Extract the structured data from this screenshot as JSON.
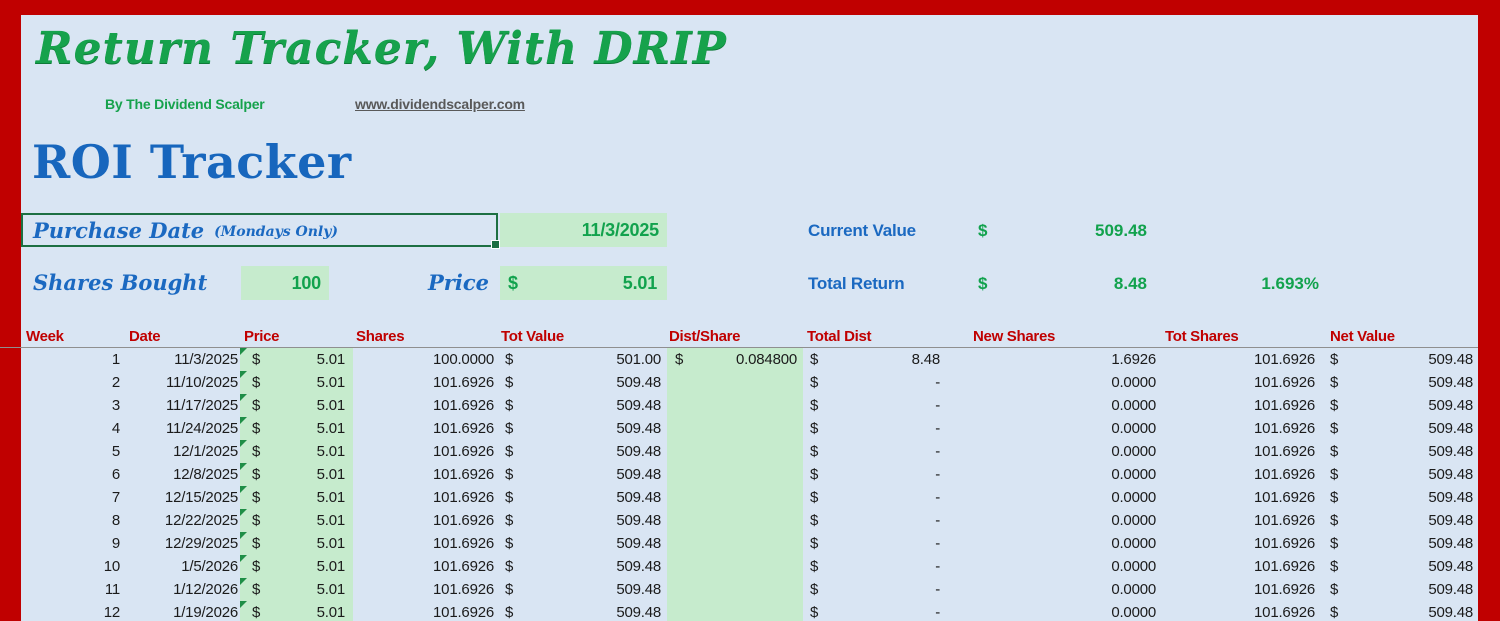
{
  "header": {
    "title": "Return Tracker, With DRIP",
    "byline": "By The Dividend Scalper",
    "website": "www.dividendscalper.com"
  },
  "section": {
    "title": "ROI Tracker"
  },
  "inputs": {
    "purchase_date_label": "Purchase Date",
    "purchase_date_note": "(Mondays Only)",
    "purchase_date_value": "11/3/2025",
    "shares_bought_label": "Shares Bought",
    "shares_bought_value": "100",
    "price_label": "Price",
    "price_currency": "$",
    "price_value": "5.01"
  },
  "summary": {
    "current_value_label": "Current Value",
    "current_value_currency": "$",
    "current_value": "509.48",
    "total_return_label": "Total Return",
    "total_return_currency": "$",
    "total_return": "8.48",
    "total_return_pct": "1.693%"
  },
  "colors": {
    "border_red": "#C00000",
    "sheet_blue": "#D9E5F3",
    "fill_green": "#C6EBCD",
    "text_green": "#12A24D",
    "text_blue": "#1B69C1",
    "header_red": "#C00000",
    "selection_green": "#1D6F42"
  },
  "table": {
    "columns": [
      "Week",
      "Date",
      "Price",
      "Shares",
      "Tot Value",
      "Dist/Share",
      "Total Dist",
      "New Shares",
      "Tot Shares",
      "Net Value"
    ],
    "rows": [
      {
        "week": "1",
        "date": "11/3/2025",
        "price_cur": "$",
        "price": "5.01",
        "shares": "100.0000",
        "tot_value_cur": "$",
        "tot_value": "501.00",
        "dist_cur": "$",
        "dist_share": "0.084800",
        "total_dist_cur": "$",
        "total_dist": "8.48",
        "new_shares": "1.6926",
        "tot_shares": "101.6926",
        "net_value_cur": "$",
        "net_value": "509.48"
      },
      {
        "week": "2",
        "date": "11/10/2025",
        "price_cur": "$",
        "price": "5.01",
        "shares": "101.6926",
        "tot_value_cur": "$",
        "tot_value": "509.48",
        "dist_cur": "",
        "dist_share": "",
        "total_dist_cur": "$",
        "total_dist": "-",
        "new_shares": "0.0000",
        "tot_shares": "101.6926",
        "net_value_cur": "$",
        "net_value": "509.48"
      },
      {
        "week": "3",
        "date": "11/17/2025",
        "price_cur": "$",
        "price": "5.01",
        "shares": "101.6926",
        "tot_value_cur": "$",
        "tot_value": "509.48",
        "dist_cur": "",
        "dist_share": "",
        "total_dist_cur": "$",
        "total_dist": "-",
        "new_shares": "0.0000",
        "tot_shares": "101.6926",
        "net_value_cur": "$",
        "net_value": "509.48"
      },
      {
        "week": "4",
        "date": "11/24/2025",
        "price_cur": "$",
        "price": "5.01",
        "shares": "101.6926",
        "tot_value_cur": "$",
        "tot_value": "509.48",
        "dist_cur": "",
        "dist_share": "",
        "total_dist_cur": "$",
        "total_dist": "-",
        "new_shares": "0.0000",
        "tot_shares": "101.6926",
        "net_value_cur": "$",
        "net_value": "509.48"
      },
      {
        "week": "5",
        "date": "12/1/2025",
        "price_cur": "$",
        "price": "5.01",
        "shares": "101.6926",
        "tot_value_cur": "$",
        "tot_value": "509.48",
        "dist_cur": "",
        "dist_share": "",
        "total_dist_cur": "$",
        "total_dist": "-",
        "new_shares": "0.0000",
        "tot_shares": "101.6926",
        "net_value_cur": "$",
        "net_value": "509.48"
      },
      {
        "week": "6",
        "date": "12/8/2025",
        "price_cur": "$",
        "price": "5.01",
        "shares": "101.6926",
        "tot_value_cur": "$",
        "tot_value": "509.48",
        "dist_cur": "",
        "dist_share": "",
        "total_dist_cur": "$",
        "total_dist": "-",
        "new_shares": "0.0000",
        "tot_shares": "101.6926",
        "net_value_cur": "$",
        "net_value": "509.48"
      },
      {
        "week": "7",
        "date": "12/15/2025",
        "price_cur": "$",
        "price": "5.01",
        "shares": "101.6926",
        "tot_value_cur": "$",
        "tot_value": "509.48",
        "dist_cur": "",
        "dist_share": "",
        "total_dist_cur": "$",
        "total_dist": "-",
        "new_shares": "0.0000",
        "tot_shares": "101.6926",
        "net_value_cur": "$",
        "net_value": "509.48"
      },
      {
        "week": "8",
        "date": "12/22/2025",
        "price_cur": "$",
        "price": "5.01",
        "shares": "101.6926",
        "tot_value_cur": "$",
        "tot_value": "509.48",
        "dist_cur": "",
        "dist_share": "",
        "total_dist_cur": "$",
        "total_dist": "-",
        "new_shares": "0.0000",
        "tot_shares": "101.6926",
        "net_value_cur": "$",
        "net_value": "509.48"
      },
      {
        "week": "9",
        "date": "12/29/2025",
        "price_cur": "$",
        "price": "5.01",
        "shares": "101.6926",
        "tot_value_cur": "$",
        "tot_value": "509.48",
        "dist_cur": "",
        "dist_share": "",
        "total_dist_cur": "$",
        "total_dist": "-",
        "new_shares": "0.0000",
        "tot_shares": "101.6926",
        "net_value_cur": "$",
        "net_value": "509.48"
      },
      {
        "week": "10",
        "date": "1/5/2026",
        "price_cur": "$",
        "price": "5.01",
        "shares": "101.6926",
        "tot_value_cur": "$",
        "tot_value": "509.48",
        "dist_cur": "",
        "dist_share": "",
        "total_dist_cur": "$",
        "total_dist": "-",
        "new_shares": "0.0000",
        "tot_shares": "101.6926",
        "net_value_cur": "$",
        "net_value": "509.48"
      },
      {
        "week": "11",
        "date": "1/12/2026",
        "price_cur": "$",
        "price": "5.01",
        "shares": "101.6926",
        "tot_value_cur": "$",
        "tot_value": "509.48",
        "dist_cur": "",
        "dist_share": "",
        "total_dist_cur": "$",
        "total_dist": "-",
        "new_shares": "0.0000",
        "tot_shares": "101.6926",
        "net_value_cur": "$",
        "net_value": "509.48"
      },
      {
        "week": "12",
        "date": "1/19/2026",
        "price_cur": "$",
        "price": "5.01",
        "shares": "101.6926",
        "tot_value_cur": "$",
        "tot_value": "509.48",
        "dist_cur": "",
        "dist_share": "",
        "total_dist_cur": "$",
        "total_dist": "-",
        "new_shares": "0.0000",
        "tot_shares": "101.6926",
        "net_value_cur": "$",
        "net_value": "509.48"
      }
    ]
  }
}
